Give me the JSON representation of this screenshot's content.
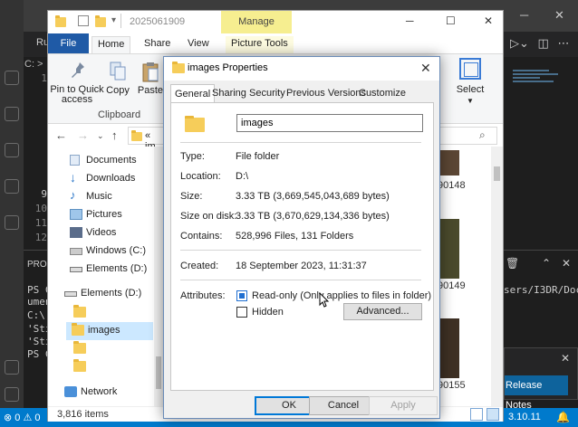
{
  "vscode": {
    "tab_label": "Ru",
    "breadcrumb": "C: >",
    "line_numbers": [
      "1",
      "",
      "9",
      "10",
      "11",
      "12"
    ],
    "terminal_title": "PRO",
    "terminal_lines": [
      "PS C",
      "umen",
      "C:\\",
      "'Sti",
      "'Sti",
      "PS C"
    ],
    "terminal_right": "sers/I3DR/Doc",
    "notification_button": "Release Notes",
    "status_left": "⊗ 0 ⚠ 0",
    "status_right": "3.10.11",
    "colors": {
      "statusbar": "#007acc",
      "editor": "#1e1e1e"
    }
  },
  "explorer": {
    "window_title": "2025061909",
    "manage_label": "Manage",
    "tabs": {
      "file": "File",
      "home": "Home",
      "share": "Share",
      "view": "View",
      "picture_tools": "Picture Tools"
    },
    "ribbon": {
      "pin_label": "Pin to Quick access",
      "copy_label": "Copy",
      "paste_label": "Paste",
      "group_label": "Clipboard",
      "select_label": "Select"
    },
    "address_text": "« im",
    "sidebar": [
      {
        "label": "Documents",
        "icon": "documents-icon"
      },
      {
        "label": "Downloads",
        "icon": "downloads-icon"
      },
      {
        "label": "Music",
        "icon": "music-icon"
      },
      {
        "label": "Pictures",
        "icon": "pictures-icon"
      },
      {
        "label": "Videos",
        "icon": "videos-icon"
      },
      {
        "label": "Windows (C:)",
        "icon": "drive-icon"
      },
      {
        "label": "Elements (D:)",
        "icon": "drive-icon"
      },
      {
        "label": "Elements (D:)",
        "icon": "drive-icon"
      },
      {
        "label": "images",
        "icon": "folder-icon"
      },
      {
        "label": "Network",
        "icon": "network-icon"
      }
    ],
    "thumb_labels": [
      "90148",
      "90149",
      "90155"
    ],
    "status_text": "3,816 items"
  },
  "dialog": {
    "title": "images Properties",
    "tabs": [
      "General",
      "Sharing",
      "Security",
      "Previous Versions",
      "Customize"
    ],
    "name_value": "images",
    "rows": [
      {
        "label": "Type:",
        "value": "File folder"
      },
      {
        "label": "Location:",
        "value": "D:\\"
      },
      {
        "label": "Size:",
        "value": "3.33 TB (3,669,545,043,689 bytes)"
      },
      {
        "label": "Size on disk:",
        "value": "3.33 TB (3,670,629,134,336 bytes)"
      },
      {
        "label": "Contains:",
        "value": "528,996 Files, 131 Folders"
      },
      {
        "label": "Created:",
        "value": "18 September 2023, 11:31:37"
      }
    ],
    "attributes_label": "Attributes:",
    "readonly_label": "Read-only (Only applies to files in folder)",
    "hidden_label": "Hidden",
    "advanced_label": "Advanced...",
    "buttons": {
      "ok": "OK",
      "cancel": "Cancel",
      "apply": "Apply"
    }
  }
}
